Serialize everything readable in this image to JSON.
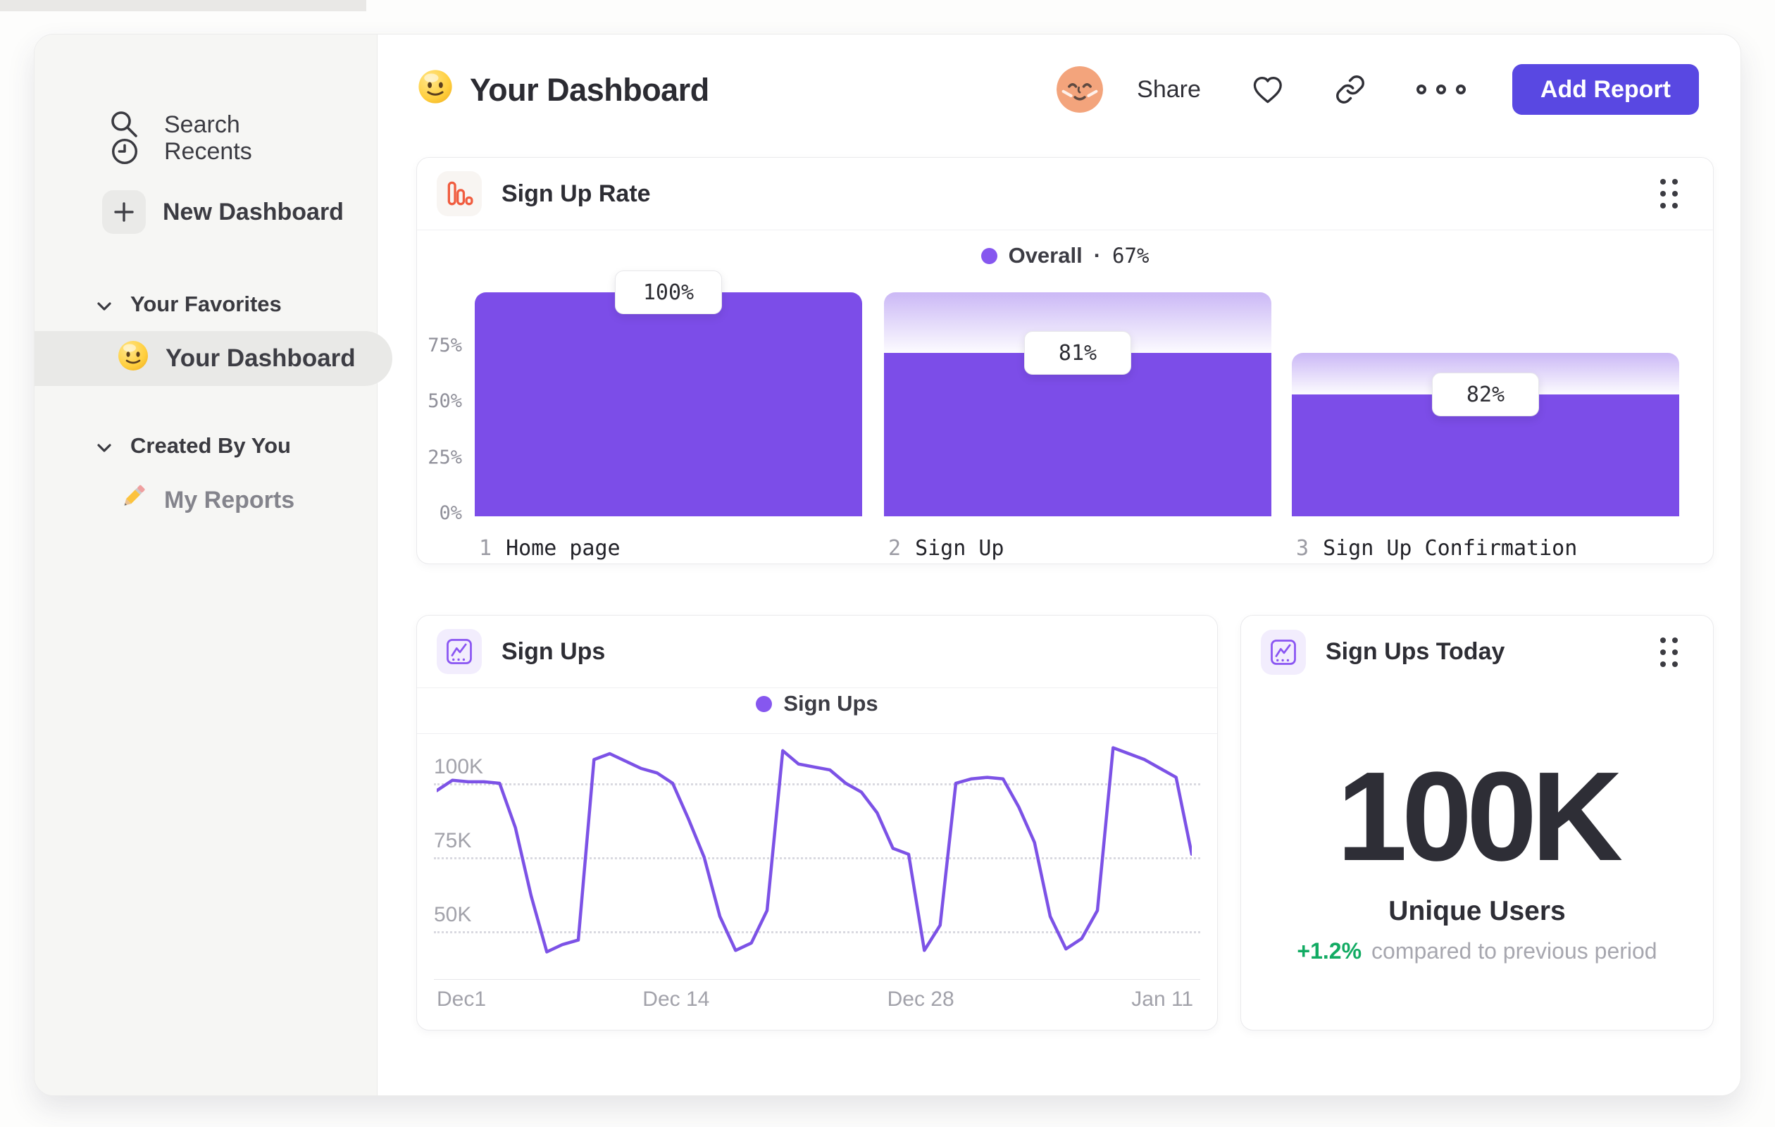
{
  "sidebar": {
    "nav": [
      {
        "label": "Search",
        "icon": "search-icon"
      },
      {
        "label": "Recents",
        "icon": "clock-icon"
      },
      {
        "label": "New Dashboard",
        "icon": "plus-icon"
      }
    ],
    "sections": [
      {
        "label": "Your Favorites",
        "items": [
          {
            "label": "Your Dashboard",
            "icon": "smiley-emoji",
            "selected": true
          }
        ]
      },
      {
        "label": "Created By You",
        "items": [
          {
            "label": "My Reports",
            "icon": "pencil-emoji",
            "selected": false
          }
        ]
      }
    ]
  },
  "header": {
    "title": "Your Dashboard",
    "share_label": "Share",
    "add_report_label": "Add Report"
  },
  "colors": {
    "accent_purple": "#7C4DE8",
    "button_purple": "#5948E2",
    "legend_dot_purple": "#8657EF",
    "funnel_icon_orange": "#F05C3F",
    "chart_icon_purple": "#8A55F2",
    "positive_green": "#12AB63"
  },
  "chart_data": [
    {
      "id": "signup_rate_funnel",
      "type": "bar",
      "title": "Sign Up Rate",
      "legend": {
        "label": "Overall",
        "separator": "·",
        "value": "67%"
      },
      "step_numbers": [
        "1",
        "2",
        "3"
      ],
      "categories": [
        "Home page",
        "Sign Up",
        "Sign Up Confirmation"
      ],
      "values": [
        100,
        81,
        82
      ],
      "value_labels": [
        "100%",
        "81%",
        "82%"
      ],
      "overall_conversion": "67%",
      "yticks": [
        "75%",
        "50%",
        "25%",
        "0%"
      ],
      "ytick_values": [
        75,
        50,
        25,
        0
      ],
      "ylim": [
        0,
        100
      ],
      "render": {
        "solid_fraction": [
          1.0,
          0.73,
          0.545
        ],
        "fade_top_fraction": [
          1.0,
          1.0,
          0.73
        ]
      }
    },
    {
      "id": "signups_line",
      "type": "line",
      "title": "Sign Ups",
      "legend": {
        "label": "Sign Ups"
      },
      "unit": "K",
      "yticks": [
        "100K",
        "75K",
        "50K"
      ],
      "ytick_values": [
        100,
        75,
        50
      ],
      "xticks": [
        {
          "label": "Dec1",
          "pos": 0.0
        },
        {
          "label": "Dec 14",
          "pos": 0.317
        },
        {
          "label": "Dec 28",
          "pos": 0.641
        },
        {
          "label": "Jan 11",
          "pos": 0.961
        }
      ],
      "values_k": [
        97.5,
        101,
        100.5,
        100.5,
        100,
        85,
        62,
        43,
        45.5,
        47,
        108,
        110,
        107.5,
        105,
        103.5,
        100,
        88,
        75,
        55,
        43.5,
        46,
        57,
        111,
        106.5,
        105.5,
        104.5,
        100,
        97,
        90,
        78,
        76,
        43.5,
        52,
        100,
        101.5,
        102,
        101.5,
        92,
        80,
        55,
        44,
        47.5,
        57,
        112,
        110,
        108,
        105,
        102,
        76
      ]
    },
    {
      "id": "signups_today",
      "type": "number",
      "title": "Sign Ups Today",
      "value": "100K",
      "label": "Unique Users",
      "delta": "+1.2%",
      "delta_note": "compared to previous period"
    }
  ]
}
